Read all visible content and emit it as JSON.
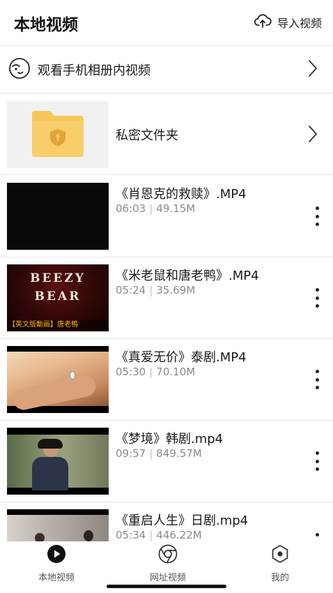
{
  "header": {
    "title": "本地视频",
    "import_label": "导入视频",
    "import_icon": "cloud-upload-icon"
  },
  "album": {
    "label": "观看手机相册内视频",
    "icon": "face-icon"
  },
  "private_folder": {
    "label": "私密文件夹",
    "icon": "locked-folder-icon",
    "folder_color": "#F6C65A"
  },
  "videos": [
    {
      "name": "《肖恩克的救赎》.MP4",
      "duration": "06:03",
      "size": "49.15M"
    },
    {
      "name": "《米老鼠和唐老鸭》.MP4",
      "duration": "05:24",
      "size": "35.69M",
      "thumb_text_1": "BEEZY",
      "thumb_text_2": "BEAR",
      "thumb_caption": "【英文版動画】唐老鴨"
    },
    {
      "name": "《真爱无价》泰剧.MP4",
      "duration": "05:30",
      "size": "70.10M"
    },
    {
      "name": "《梦境》韩剧.mp4",
      "duration": "09:57",
      "size": "849.57M"
    },
    {
      "name": "《重启人生》日剧.mp4",
      "duration": "05:34",
      "size": "446.22M"
    }
  ],
  "tabs": [
    {
      "label": "本地视频",
      "icon": "play-circle-icon",
      "active": true
    },
    {
      "label": "网址视频",
      "icon": "browser-icon",
      "active": false
    },
    {
      "label": "我的",
      "icon": "hexagon-icon",
      "active": false
    }
  ],
  "colors": {
    "divider": "#E6E6E6",
    "meta_text": "#8A8A8A",
    "folder": "#F6C65A"
  }
}
